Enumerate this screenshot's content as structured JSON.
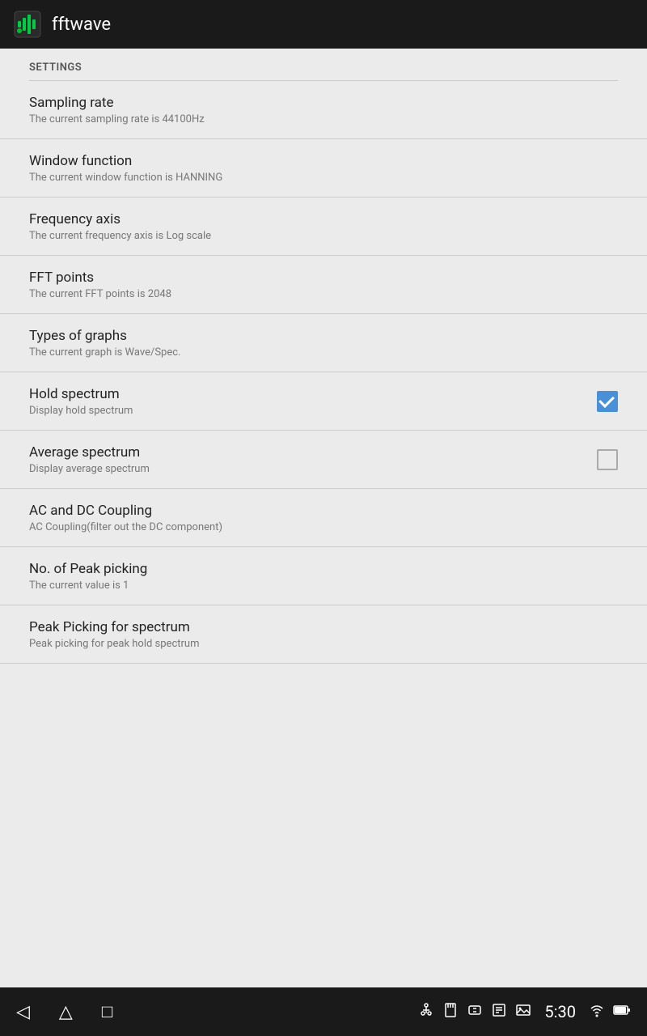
{
  "appBar": {
    "title": "fftwave"
  },
  "settings": {
    "sectionLabel": "SETTINGS",
    "items": [
      {
        "id": "sampling-rate",
        "title": "Sampling rate",
        "subtitle": "The current sampling rate is 44100Hz",
        "hasControl": false
      },
      {
        "id": "window-function",
        "title": "Window function",
        "subtitle": "The current window function is HANNING",
        "hasControl": false
      },
      {
        "id": "frequency-axis",
        "title": "Frequency axis",
        "subtitle": "The current frequency axis is Log scale",
        "hasControl": false
      },
      {
        "id": "fft-points",
        "title": "FFT points",
        "subtitle": "The current FFT points is 2048",
        "hasControl": false
      },
      {
        "id": "types-of-graphs",
        "title": "Types of graphs",
        "subtitle": "The current graph is Wave/Spec.",
        "hasControl": false
      },
      {
        "id": "hold-spectrum",
        "title": "Hold spectrum",
        "subtitle": "Display hold spectrum",
        "hasControl": true,
        "checked": true
      },
      {
        "id": "average-spectrum",
        "title": "Average spectrum",
        "subtitle": "Display average spectrum",
        "hasControl": true,
        "checked": false
      },
      {
        "id": "ac-dc-coupling",
        "title": "AC and DC Coupling",
        "subtitle": "AC Coupling(filter out the DC component)",
        "hasControl": false
      },
      {
        "id": "no-peak-picking",
        "title": "No. of Peak picking",
        "subtitle": "The current value is 1",
        "hasControl": false
      },
      {
        "id": "peak-picking-spectrum",
        "title": "Peak Picking for spectrum",
        "subtitle": "Peak picking for peak hold spectrum",
        "hasControl": false
      }
    ]
  },
  "navBar": {
    "time": "5:30",
    "backIcon": "◁",
    "homeIcon": "△",
    "recentIcon": "□"
  }
}
